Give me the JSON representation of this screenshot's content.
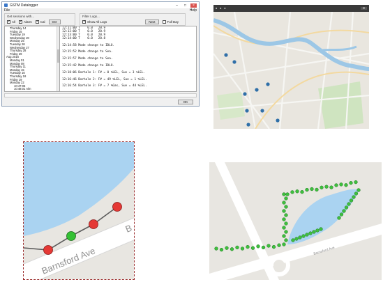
{
  "window": {
    "title": "GSTM Datalogger",
    "menu": {
      "file": "File",
      "help": "Help"
    },
    "sessions_group": {
      "label": "Get sessions with...",
      "options": [
        {
          "label": "All",
          "checked": true
        },
        {
          "label": "Alarm",
          "checked": true
        },
        {
          "label": "Cal",
          "checked": true
        }
      ],
      "go_button": "GO"
    },
    "filter_group": {
      "label": "Filter Logs...",
      "show_all_logs": {
        "label": "Show All Logs",
        "checked": true
      },
      "next_button": "Next",
      "full_day": {
        "label": "Full Day",
        "checked": false
      }
    },
    "tree": [
      {
        "level": 1,
        "text": "Thursday 14"
      },
      {
        "level": 1,
        "text": "Friday 15"
      },
      {
        "level": 1,
        "text": "Tuesday 19"
      },
      {
        "level": 1,
        "text": "Wednesday 20"
      },
      {
        "level": 1,
        "text": "Monday 25"
      },
      {
        "level": 1,
        "text": "Tuesday 26"
      },
      {
        "level": 1,
        "text": "Wednesday 27"
      },
      {
        "level": 1,
        "text": "Thursday 28"
      },
      {
        "level": 1,
        "text": "Friday 29"
      },
      {
        "level": 0,
        "text": "Aug 2016"
      },
      {
        "level": 1,
        "text": "Monday 01"
      },
      {
        "level": 1,
        "text": "Monday 08"
      },
      {
        "level": 1,
        "text": "Thursday 11"
      },
      {
        "level": 1,
        "text": "Monday 15"
      },
      {
        "level": 1,
        "text": "Tuesday 16"
      },
      {
        "level": 1,
        "text": "Thursday 18"
      },
      {
        "level": 1,
        "text": "Friday 19"
      },
      {
        "level": 1,
        "text": "Monday 22"
      },
      {
        "level": 2,
        "text": "10:47:06"
      },
      {
        "level": 2,
        "text": "10:48:01  Alm"
      }
    ],
    "log_lines": [
      "12:11:00 T    0.0   20.9",
      "12:12:00 T    0.0   20.9",
      "12:13:00 T    0.0   20.9",
      "12:14:00 T    0.0   20.8",
      "",
      "12:14:58 Mode change to IDLO.",
      "",
      "12:15:52 Mode change to Sea.",
      "",
      "12:15:57 Mode change to Sea.",
      "",
      "12:15:42 Mode change to IDLO.",
      "",
      "12:18:06 Barhole 1: F# = 0 %LEL, Sue = 3 %LEL.",
      "",
      "12:16:46 Barhole 2: F# = 49 %LEL, Sue = 1 %LEL.",
      "",
      "12:16:54 Barhole 3: F# = 7 %Gas, Sue = 44 %LEL."
    ],
    "ok_button": "OK"
  },
  "route_map": {
    "street_label": "Barnsford Ave"
  },
  "detail_map": {
    "street_label": "Barnsford Ave",
    "edge_letter": "B"
  }
}
